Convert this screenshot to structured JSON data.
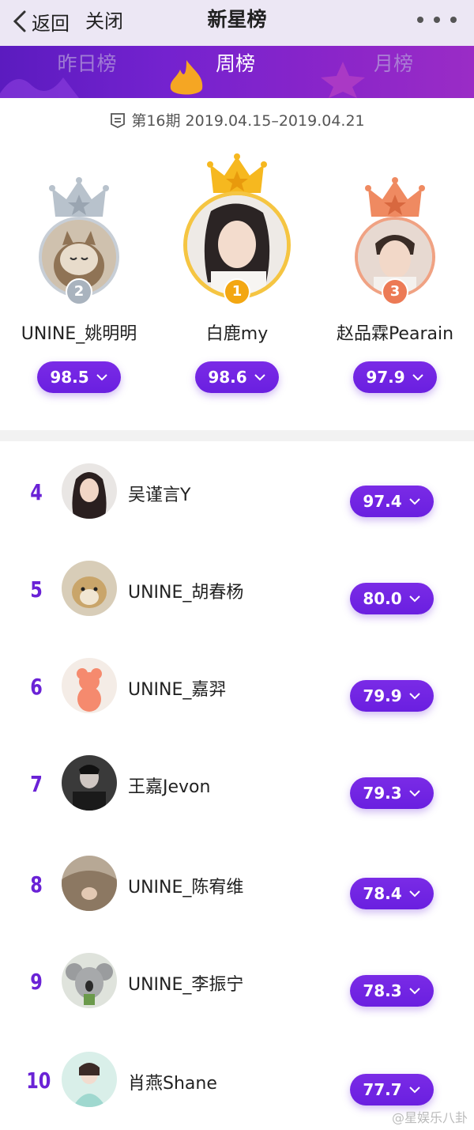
{
  "nav": {
    "back_label": "返回",
    "close_label": "关闭",
    "title": "新星榜"
  },
  "tabs": [
    {
      "label": "昨日榜",
      "active": false
    },
    {
      "label": "周榜",
      "active": true
    },
    {
      "label": "月榜",
      "active": false
    }
  ],
  "period": {
    "text": "第16期 2019.04.15–2019.04.21"
  },
  "podium": [
    {
      "rank": "2",
      "name": "UNINE_姚明明",
      "score": "98.5",
      "crown_color": "#b8c2cc",
      "badge_color": "#a9b3be"
    },
    {
      "rank": "1",
      "name": "白鹿my",
      "score": "98.6",
      "crown_color": "#f6b81f",
      "badge_color": "#f3a712"
    },
    {
      "rank": "3",
      "name": "赵品霖Pearain",
      "score": "97.9",
      "crown_color": "#ef8a61",
      "badge_color": "#ec7a55"
    }
  ],
  "list": [
    {
      "rank": "4",
      "name": "吴谨言Y",
      "score": "97.4"
    },
    {
      "rank": "5",
      "name": "UNINE_胡春杨",
      "score": "80.0"
    },
    {
      "rank": "6",
      "name": "UNINE_嘉羿",
      "score": "79.9"
    },
    {
      "rank": "7",
      "name": "王嘉Jevon",
      "score": "79.3"
    },
    {
      "rank": "8",
      "name": "UNINE_陈宥维",
      "score": "78.4"
    },
    {
      "rank": "9",
      "name": "UNINE_李振宁",
      "score": "78.3"
    },
    {
      "rank": "10",
      "name": "肖燕Shane",
      "score": "77.7"
    }
  ],
  "watermark": "@星娱乐八卦",
  "colors": {
    "accent": "#6a22d6",
    "button": "#6a1fe0",
    "nav_bg": "#ece7f4"
  }
}
